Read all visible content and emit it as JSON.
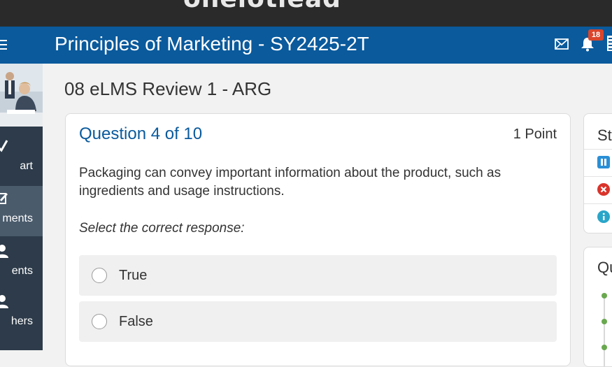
{
  "browser": {
    "partial_title": "onelotlead"
  },
  "header": {
    "course_title": "Principles of Marketing - SY2425-2T",
    "notification_count": "18"
  },
  "sidebar": {
    "items": [
      {
        "label": "art",
        "icon": "pencil-check-icon",
        "active": false
      },
      {
        "label": "ments",
        "icon": "edit-icon",
        "active": true
      },
      {
        "label": "ents",
        "icon": "person-icon",
        "active": false
      },
      {
        "label": "hers",
        "icon": "person-icon",
        "active": false
      }
    ]
  },
  "page": {
    "title": "08 eLMS Review 1 - ARG"
  },
  "question": {
    "number": "Question 4 of 10",
    "points": "1 Point",
    "text": "Packaging can convey important information about the product, such as ingredients and usage instructions.",
    "instruction": "Select the correct response:",
    "options": [
      {
        "label": "True",
        "selected": false
      },
      {
        "label": "False",
        "selected": false
      }
    ]
  },
  "status_panel": {
    "title": "St",
    "icons": [
      "pause-icon",
      "error-icon",
      "info-icon"
    ]
  },
  "question_list_panel": {
    "title": "Qu"
  },
  "colors": {
    "header_bg": "#0a5a9c",
    "sidebar_bg": "#2d3b4a",
    "accent": "#0a5a9c",
    "badge": "#d9462b",
    "progress_dot": "#6aa84f"
  }
}
